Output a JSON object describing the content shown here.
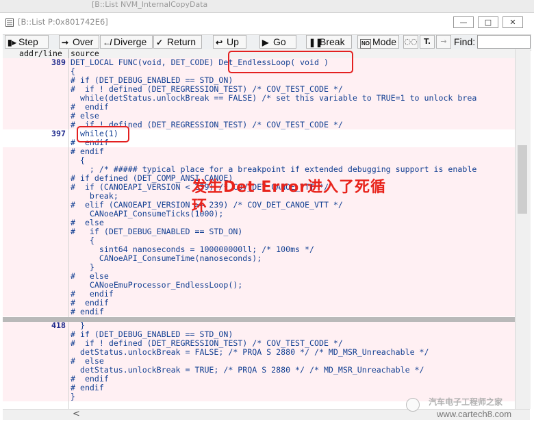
{
  "background_window": {
    "title": "[B::List NVM_InternalCopyData"
  },
  "window": {
    "title": "[B::List P:0x801742E6]",
    "controls": [
      "minimize",
      "restore",
      "close"
    ]
  },
  "toolbar": {
    "step": "Step",
    "over": "Over",
    "diverge": "Diverge",
    "return": "Return",
    "up": "Up",
    "go": "Go",
    "break": "Break",
    "mode": "Mode",
    "mode_icon_text": "NO",
    "find_label": "Find:",
    "find_value": ""
  },
  "columns": {
    "addr_line": "addr/line",
    "source": "source"
  },
  "code_lines": [
    {
      "ln": "389",
      "src": "DET_LOCAL FUNC(void, DET_CODE) Det_EndlessLoop( void )",
      "pink": true
    },
    {
      "ln": "",
      "src": "{",
      "pink": true
    },
    {
      "ln": "",
      "src": "# if (DET_DEBUG_ENABLED == STD_ON)",
      "pink": true
    },
    {
      "ln": "",
      "src": "#  if ! defined (DET_REGRESSION_TEST) /* COV_TEST_CODE */",
      "pink": true
    },
    {
      "ln": "",
      "src": "  while(detStatus.unlockBreak == FALSE) /* set this variable to TRUE=1 to unlock brea",
      "pink": true
    },
    {
      "ln": "",
      "src": "#  endif",
      "pink": true
    },
    {
      "ln": "",
      "src": "# else",
      "pink": true
    },
    {
      "ln": "",
      "src": "#  if ! defined (DET_REGRESSION_TEST) /* COV_TEST_CODE */",
      "pink": true
    },
    {
      "ln": "397",
      "src": "  while(1)",
      "pink": false
    },
    {
      "ln": "",
      "src": "#  endif",
      "pink": false
    },
    {
      "ln": "",
      "src": "# endif",
      "pink": true
    },
    {
      "ln": "",
      "src": "  {",
      "pink": true
    },
    {
      "ln": "",
      "src": "    ; /* ##### typical place for a breakpoint if extended debugging support is enable",
      "pink": true
    },
    {
      "ln": "",
      "src": "# if defined (DET_COMP_ANSI_CANOE)",
      "pink": true
    },
    {
      "ln": "",
      "src": "#  if (CANOEAPI_VERSION < 239) /* COV_DET_CANOE_VTT */",
      "pink": true
    },
    {
      "ln": "",
      "src": "    break;",
      "pink": true
    },
    {
      "ln": "",
      "src": "#  elif (CANOEAPI_VERSION >= 239) /* COV_DET_CANOE_VTT */",
      "pink": true
    },
    {
      "ln": "",
      "src": "    CANoeAPI_ConsumeTicks(1000);",
      "pink": true
    },
    {
      "ln": "",
      "src": "#  else",
      "pink": true
    },
    {
      "ln": "",
      "src": "#   if (DET_DEBUG_ENABLED == STD_ON)",
      "pink": true
    },
    {
      "ln": "",
      "src": "    {",
      "pink": true
    },
    {
      "ln": "",
      "src": "      sint64 nanoseconds = 100000000ll; /* 100ms */",
      "pink": true
    },
    {
      "ln": "",
      "src": "      CANoeAPI_ConsumeTime(nanoseconds);",
      "pink": true
    },
    {
      "ln": "",
      "src": "    }",
      "pink": true
    },
    {
      "ln": "",
      "src": "#   else",
      "pink": true
    },
    {
      "ln": "",
      "src": "    CANoeEmuProcessor_EndlessLoop();",
      "pink": true
    },
    {
      "ln": "",
      "src": "#   endif",
      "pink": true
    },
    {
      "ln": "",
      "src": "#  endif",
      "pink": true
    },
    {
      "ln": "",
      "src": "# endif",
      "pink": true
    },
    {
      "ln": "418",
      "src": "  }",
      "pink": true
    },
    {
      "ln": "",
      "src": "# if (DET_DEBUG_ENABLED == STD_ON)",
      "pink": true
    },
    {
      "ln": "",
      "src": "#  if ! defined (DET_REGRESSION_TEST) /* COV_TEST_CODE */",
      "pink": true
    },
    {
      "ln": "",
      "src": "  detStatus.unlockBreak = FALSE; /* PRQA S 2880 */ /* MD_MSR_Unreachable */",
      "pink": true
    },
    {
      "ln": "",
      "src": "#  else",
      "pink": true
    },
    {
      "ln": "",
      "src": "  detStatus.unlockBreak = TRUE; /* PRQA S 2880 */ /* MD_MSR_Unreachable */",
      "pink": true
    },
    {
      "ln": "",
      "src": "#  endif",
      "pink": true
    },
    {
      "ln": "",
      "src": "# endif",
      "pink": true
    },
    {
      "ln": "",
      "src": "}",
      "pink": true
    }
  ],
  "annotation": {
    "text": "发生Det Error进入了死循\n环",
    "color": "#e8231b"
  },
  "watermark": {
    "line1": "汽车电子工程师之家",
    "line2": "www.cartech8.com"
  },
  "colors": {
    "code_text": "#123f92",
    "line_number": "#1e2a8c",
    "highlight_bg": "#fff0f3",
    "annotation_red": "#e32020"
  }
}
